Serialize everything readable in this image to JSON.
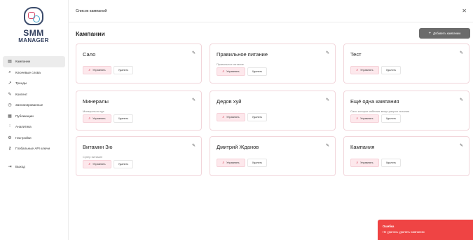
{
  "brand": {
    "line1": "SMM",
    "line2": "MANAGER"
  },
  "sidebar": {
    "items": [
      {
        "label": "Кампании",
        "icon": "document-icon",
        "glyph": "▤",
        "active": true
      },
      {
        "label": "Ключевые слова",
        "icon": "search-icon",
        "glyph": "⌕"
      },
      {
        "label": "Тренды",
        "icon": "trend-icon",
        "glyph": "↗"
      },
      {
        "label": "Контент",
        "icon": "pen-icon",
        "glyph": "✎"
      },
      {
        "label": "Запланированные",
        "icon": "clock-icon",
        "glyph": "◷"
      },
      {
        "label": "Публикации",
        "icon": "calendar-icon",
        "glyph": "▦"
      },
      {
        "label": "Аналитика",
        "icon": "chart-icon",
        "glyph": "⫶"
      },
      {
        "label": "Настройки",
        "icon": "gear-icon",
        "glyph": "⚙"
      },
      {
        "label": "Глобальные API ключи",
        "icon": "key-icon",
        "glyph": "⚷"
      }
    ],
    "logout": {
      "label": "Выход",
      "icon": "logout-icon",
      "glyph": "⇥"
    }
  },
  "topbar": {
    "title": "Список кампаний",
    "close_glyph": "✕"
  },
  "main": {
    "title": "Кампании",
    "add_button": {
      "plus": "+",
      "label": "Добавить кампанию"
    }
  },
  "campaigns": [
    {
      "name": "Сало",
      "description": ""
    },
    {
      "name": "Правильное питание",
      "description": "Правильное питание"
    },
    {
      "name": "Тест",
      "description": ""
    },
    {
      "name": "Минералы",
      "description": "Минералы в еде"
    },
    {
      "name": "Дедов хуй",
      "description": ""
    },
    {
      "name": "Ещё одна кампания",
      "description": "Сало которое избегает вещи рацион питания"
    },
    {
      "name": "Витамин Зю",
      "description": "Супер витамин"
    },
    {
      "name": "Дмитрий Жданов",
      "description": ""
    },
    {
      "name": "Кампания",
      "description": ""
    }
  ],
  "card_actions": {
    "manage": "Управлять",
    "delete": "Удалить",
    "manage_glyph": "⌕",
    "edit_glyph": "✎"
  },
  "toast": {
    "title": "Ошибка",
    "message": "Не удалось удалить кампанию",
    "color": "#ef4444"
  }
}
